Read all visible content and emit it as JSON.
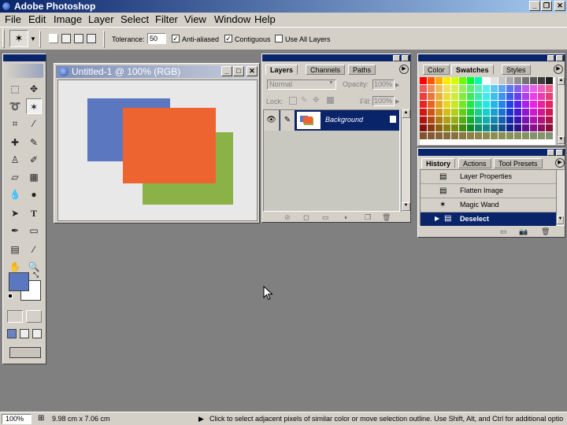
{
  "window": {
    "title": "Adobe Photoshop"
  },
  "menubar": [
    "File",
    "Edit",
    "Image",
    "Layer",
    "Select",
    "Filter",
    "View",
    "Window",
    "Help"
  ],
  "options": {
    "tolerance_label": "Tolerance:",
    "tolerance_value": "50",
    "anti_aliased": "Anti-aliased",
    "contiguous": "Contiguous",
    "use_all_layers": "Use All Layers"
  },
  "document": {
    "title": "Untitled-1 @ 100% (RGB)",
    "rect_blue": "#5a77c0",
    "rect_orange": "#ee6431",
    "rect_green": "#8bb247"
  },
  "layers_panel": {
    "tabs": [
      "Layers",
      "Channels",
      "Paths"
    ],
    "blend_mode": "Normal",
    "opacity_label": "Opacity:",
    "opacity_value": "100%",
    "lock_label": "Lock:",
    "fill_label": "Fill:",
    "fill_value": "100%",
    "layer_name": "Background"
  },
  "swatches_panel": {
    "tabs": [
      "Color",
      "Swatches",
      "Styles"
    ]
  },
  "history_panel": {
    "tabs": [
      "History",
      "Actions",
      "Tool Presets"
    ],
    "items": [
      "Layer Properties",
      "Flatten Image",
      "Magic Wand",
      "Deselect"
    ]
  },
  "status": {
    "zoom": "100%",
    "doc_size": "9.98 cm x 7.06 cm",
    "hint": "Click to select adjacent pixels of similar color or move selection outline.  Use Shift, Alt, and Ctrl for additional optio"
  },
  "colors": {
    "foreground": "#5a77c0",
    "background": "#ffffff",
    "titlebar": "#0a246a"
  }
}
